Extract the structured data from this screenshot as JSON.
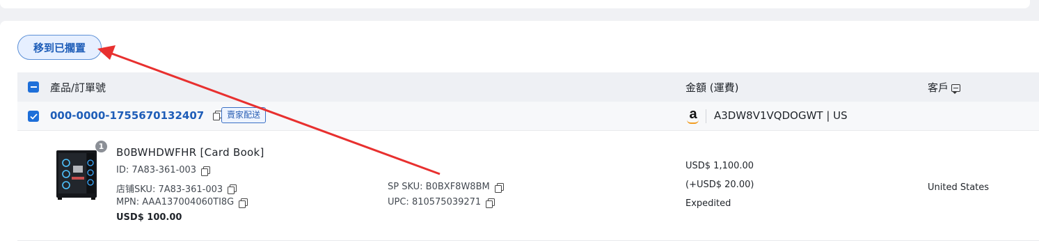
{
  "toolbar": {
    "move_button": "移到已擱置"
  },
  "table": {
    "headers": {
      "product": "產品/訂單號",
      "amount": "金額 (運費)",
      "customer": "客戶"
    }
  },
  "order": {
    "id": "000-0000-1755670132407",
    "badge": "賣家配送",
    "store_icon": "amazon-logo",
    "store": "A3DW8V1VQDOGWT | US"
  },
  "product": {
    "quantity": "1",
    "title": "B0BWHDWFHR [Card Book]",
    "id_label": "ID: 7A83-361-003",
    "shop_sku": "店铺SKU: 7A83-361-003",
    "mpn": "MPN: AAA137004060TI8G",
    "sp_sku": "SP SKU: B0BXF8W8BM",
    "upc": "UPC: 810575039271",
    "price": "USD$ 100.00"
  },
  "amount": {
    "total": "USD$ 1,100.00",
    "shipping": "(+USD$ 20.00)",
    "method": "Expedited"
  },
  "customer": {
    "country": "United States"
  },
  "annotation": {
    "arrow_color": "#e8302f"
  },
  "colors": {
    "accent": "#1e6fd9",
    "link": "#1e5db8"
  }
}
